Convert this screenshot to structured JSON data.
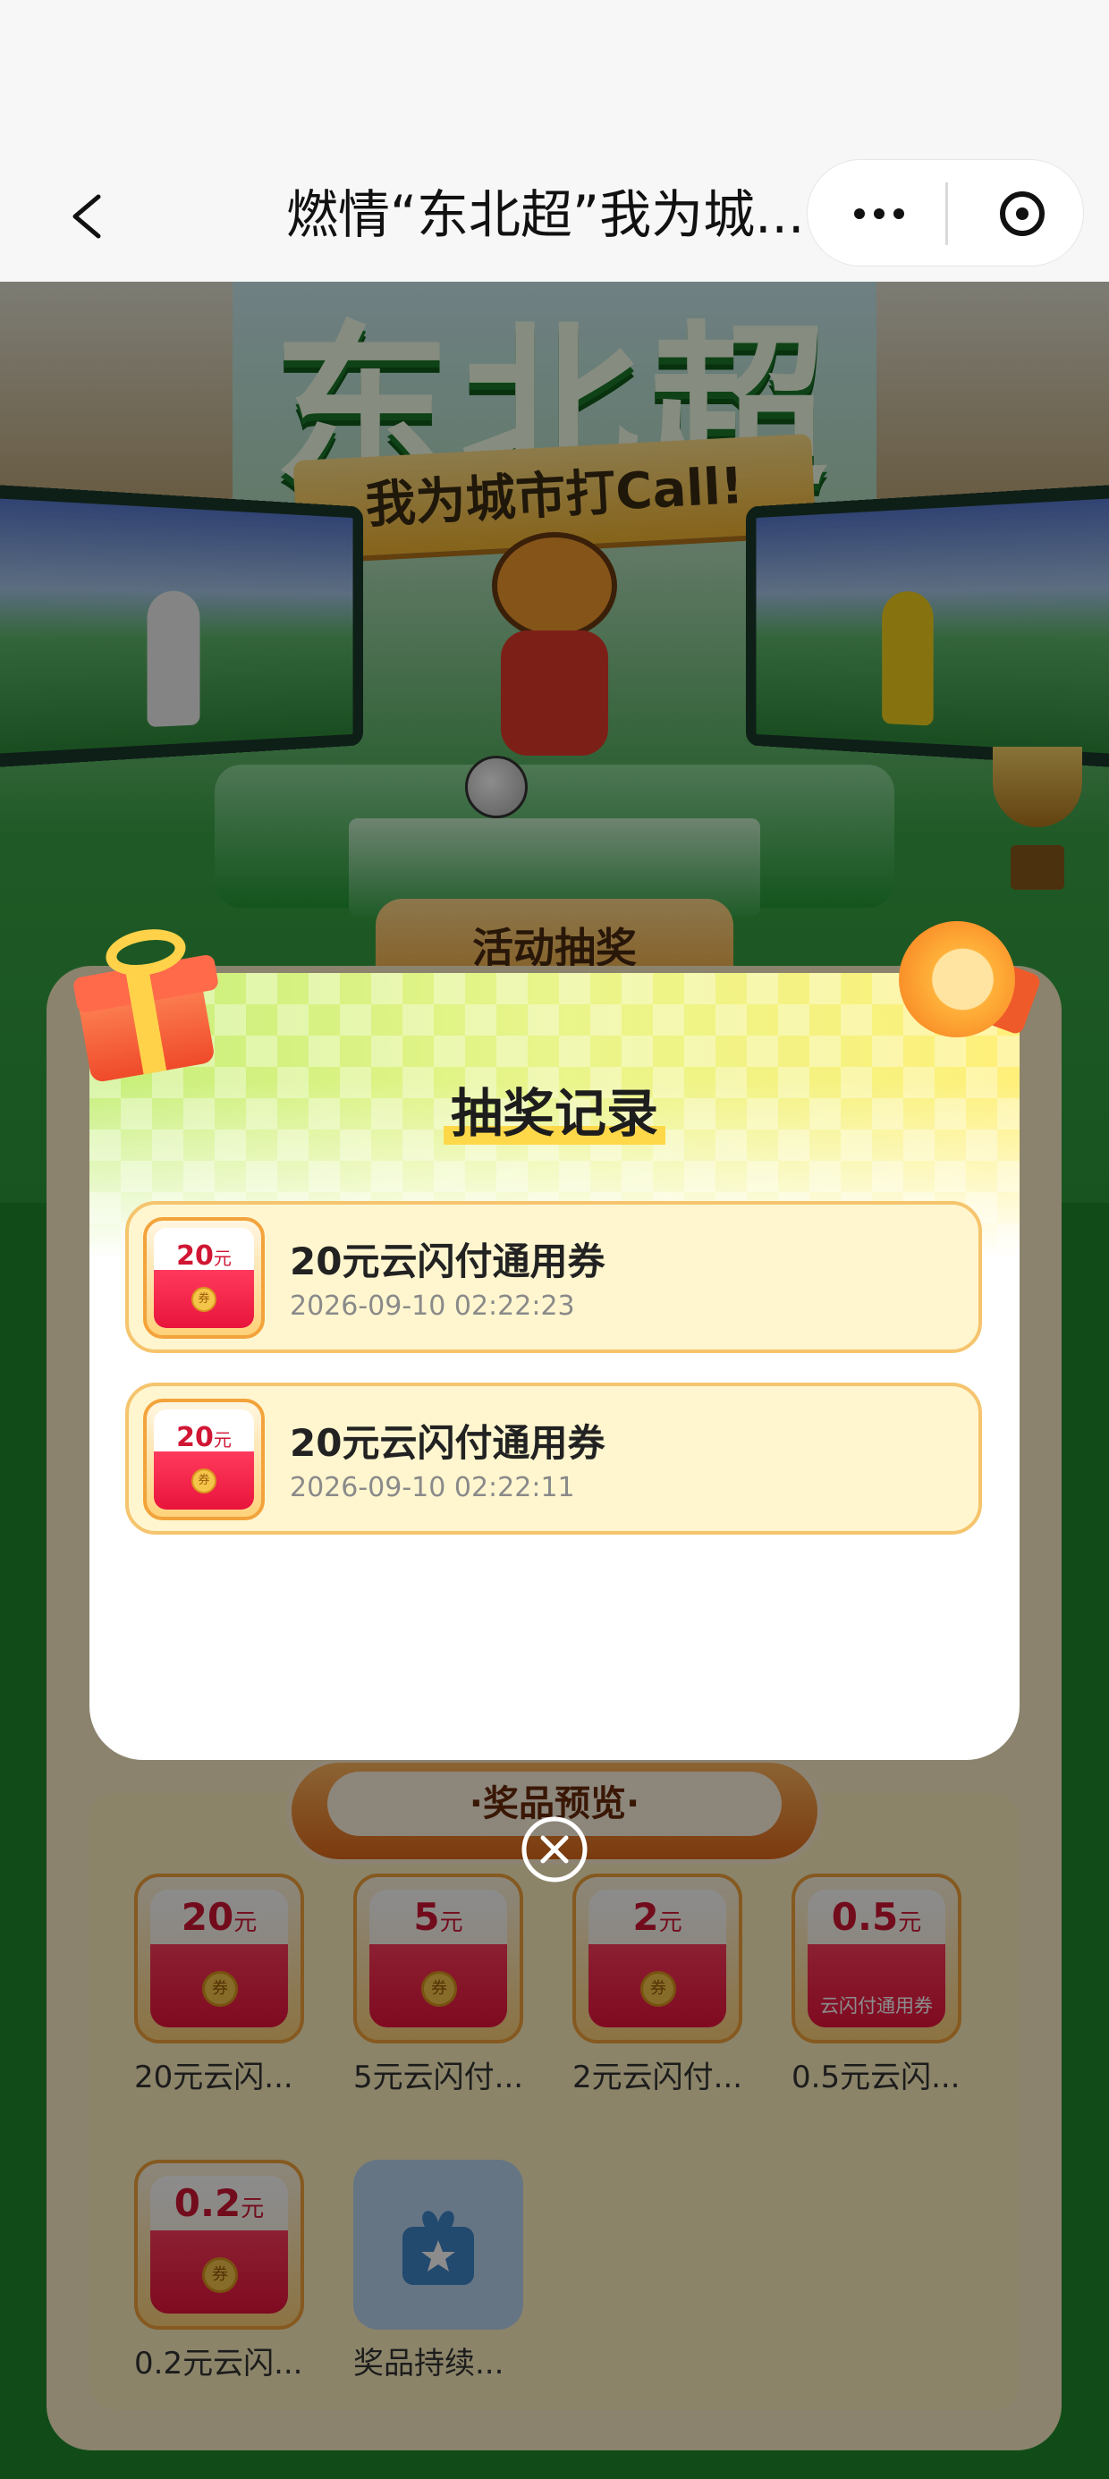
{
  "nav": {
    "title": "燃情“东北超”我为城...",
    "back_icon": "chevron-left-icon",
    "more_icon": "more-dots-icon",
    "close_icon": "circle-close-icon"
  },
  "hero": {
    "headline": "东北超",
    "ribbon_text": "我为城市打Call!"
  },
  "draw_section": {
    "tab_label": "活动抽奖"
  },
  "modal": {
    "title": "抽奖记录",
    "records": [
      {
        "amount": "20",
        "unit": "元",
        "coin": "券",
        "name": "20元云闪付通用券",
        "time": "2026-09-10 02:22:23"
      },
      {
        "amount": "20",
        "unit": "元",
        "coin": "券",
        "name": "20元云闪付通用券",
        "time": "2026-09-10 02:22:11"
      }
    ],
    "close_icon": "circle-x-icon"
  },
  "prize_preview": {
    "header": "·奖品预览·",
    "items": [
      {
        "amount": "20",
        "unit": "元",
        "coin": "券",
        "sub": "",
        "label": "20元云闪..."
      },
      {
        "amount": "5",
        "unit": "元",
        "coin": "券",
        "sub": "",
        "label": "5元云闪付..."
      },
      {
        "amount": "2",
        "unit": "元",
        "coin": "券",
        "sub": "",
        "label": "2元云闪付..."
      },
      {
        "amount": "0.5",
        "unit": "元",
        "coin": "",
        "sub": "云闪付通用券",
        "label": "0.5元云闪..."
      },
      {
        "amount": "0.2",
        "unit": "元",
        "coin": "券",
        "sub": "",
        "label": "0.2元云闪..."
      },
      {
        "amount": "",
        "unit": "",
        "coin": "",
        "sub": "",
        "label": "奖品持续..."
      }
    ]
  },
  "colors": {
    "page_green": "#1f8a2c",
    "record_bg": "#fff6cf",
    "record_border": "#f5c46d",
    "envelope_red": "#e8143c",
    "title_highlight": "#ffd84a"
  }
}
